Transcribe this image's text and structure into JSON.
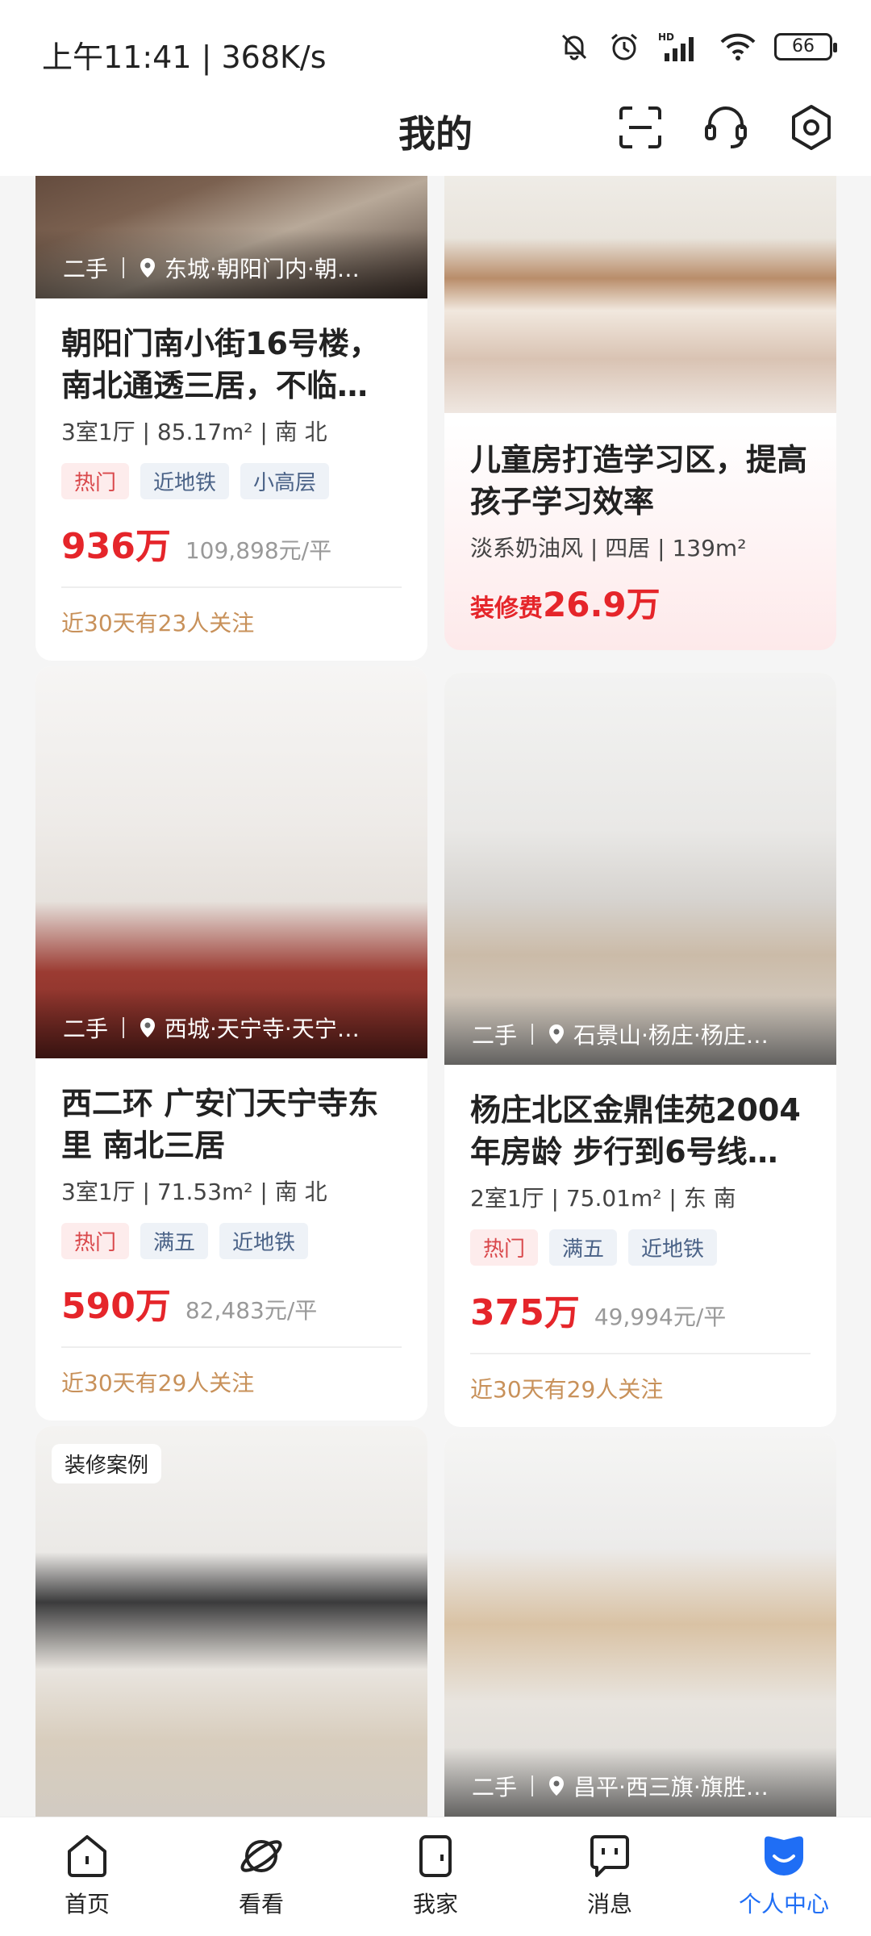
{
  "status_bar": {
    "time_speed": "上午11:41 | 368K/s",
    "battery": "66",
    "icons": [
      "mute-bell-icon",
      "alarm-icon",
      "hd-signal-icon",
      "wifi-icon",
      "battery-icon"
    ]
  },
  "header": {
    "title": "我的",
    "icons": [
      "scan-icon",
      "customer-service-icon",
      "settings-icon"
    ]
  },
  "cards": [
    {
      "caption_type": "二手",
      "caption_location": "东城·朝阳门内·朝…",
      "title": "朝阳门南小街16号楼，南北通透三居，不临…",
      "meta": "3室1厅 | 85.17m² | 南 北",
      "tags": [
        "热门",
        "近地铁",
        "小高层"
      ],
      "price": "936万",
      "unit_price": "109,898元/平",
      "follow": "近30天有23人关注"
    },
    {
      "title": "儿童房打造学习区，提高孩子学习效率",
      "meta": "淡系奶油风 | 四居 | 139m²",
      "fee_label": "装修费",
      "fee_value": "26.9万"
    },
    {
      "caption_type": "二手",
      "caption_location": "西城·天宁寺·天宁…",
      "title": "西二环 广安门天宁寺东里 南北三居",
      "meta": "3室1厅 | 71.53m² | 南 北",
      "tags": [
        "热门",
        "满五",
        "近地铁"
      ],
      "price": "590万",
      "unit_price": "82,483元/平",
      "follow": "近30天有29人关注"
    },
    {
      "caption_type": "二手",
      "caption_location": "石景山·杨庄·杨庄…",
      "title": "杨庄北区金鼎佳苑2004年房龄 步行到6号线…",
      "meta": "2室1厅 | 75.01m² | 东 南",
      "tags": [
        "热门",
        "满五",
        "近地铁"
      ],
      "price": "375万",
      "unit_price": "49,994元/平",
      "follow": "近30天有29人关注"
    },
    {
      "case_tag": "装修案例"
    },
    {
      "caption_type": "二手",
      "caption_location": "昌平·西三旗·旗胜…"
    }
  ],
  "bottom_nav": [
    {
      "label": "首页",
      "icon": "home-icon"
    },
    {
      "label": "看看",
      "icon": "planet-icon"
    },
    {
      "label": "我家",
      "icon": "my-home-icon"
    },
    {
      "label": "消息",
      "icon": "message-icon"
    },
    {
      "label": "个人中心",
      "icon": "profile-icon",
      "active": true
    }
  ],
  "colors": {
    "accent": "#1f6ef5",
    "price": "#e5252a",
    "follow": "#c8915a"
  }
}
